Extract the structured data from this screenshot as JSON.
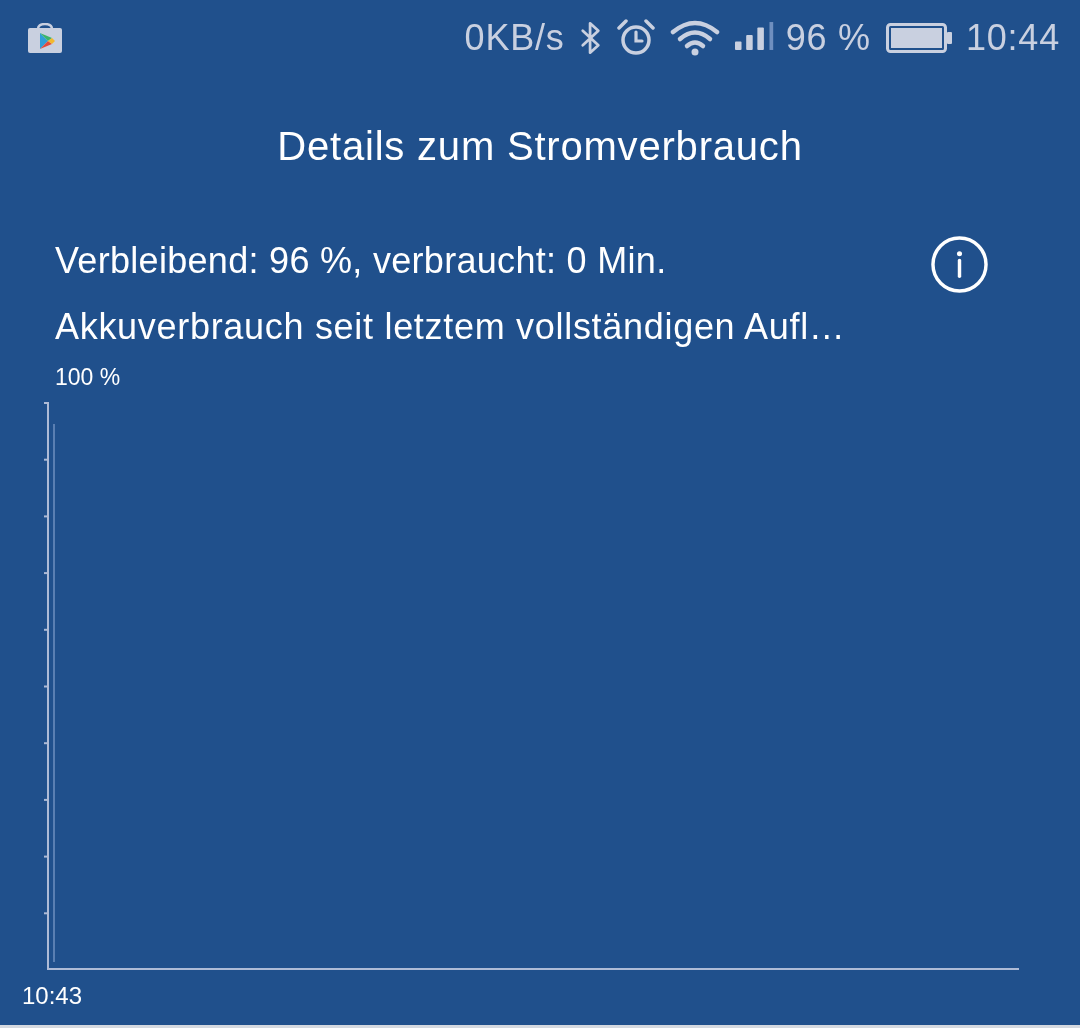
{
  "status_bar": {
    "net_speed": "0KB/s",
    "battery_percent": "96 %",
    "time": "10:44"
  },
  "title": "Details zum Stromverbrauch",
  "summary": "Verbleibend: 96 %, verbraucht: 0 Min.",
  "section_heading": "Akkuverbrauch seit letztem vollständigen Aufl…",
  "chart": {
    "y_label": "100 %",
    "x_label": "10:43"
  }
}
